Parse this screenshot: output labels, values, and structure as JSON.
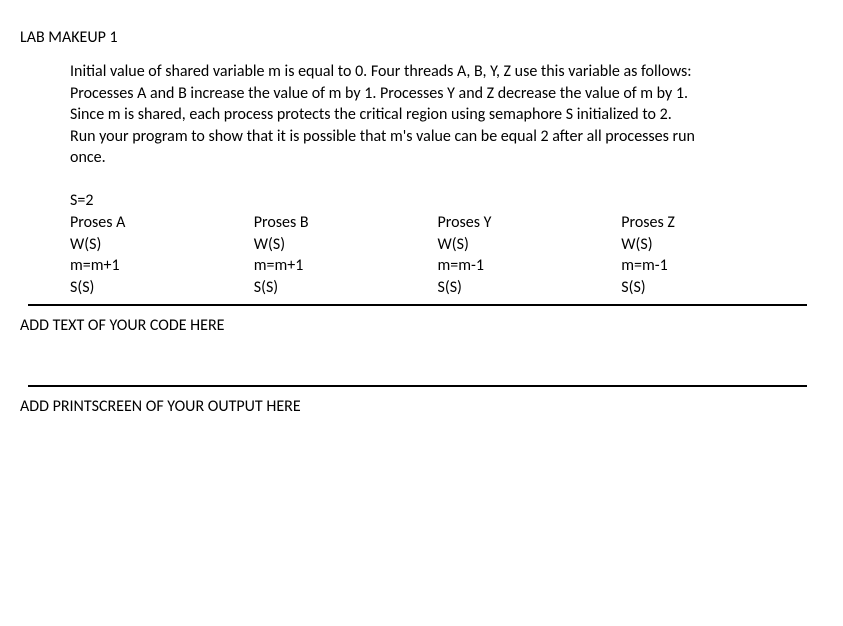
{
  "title": "LAB MAKEUP 1",
  "problem": {
    "line1": "Initial value of shared variable m is equal to 0. Four threads A, B, Y, Z use this variable as follows:",
    "line2": "Processes A and B increase the value of m by 1. Processes Y and Z decrease the value of m by 1.",
    "line3": "Since m is shared, each process protects the critical region using semaphore S initialized to 2.",
    "line4": "Run your program to show that it is possible that m's value can be equal 2 after all processes run",
    "line5": "once."
  },
  "semaphore_init": "S=2",
  "processes": [
    {
      "name": "Proses A",
      "wait": "W(S)",
      "op": "m=m+1",
      "signal": "S(S)"
    },
    {
      "name": "Proses B",
      "wait": "W(S)",
      "op": "m=m+1",
      "signal": "S(S)"
    },
    {
      "name": "Proses Y",
      "wait": "W(S)",
      "op": "m=m-1",
      "signal": "S(S)"
    },
    {
      "name": "Proses Z",
      "wait": "W(S)",
      "op": "m=m-1",
      "signal": "S(S)"
    }
  ],
  "section1_label": "ADD TEXT OF YOUR CODE HERE",
  "section2_label": "ADD PRINTSCREEN OF YOUR OUTPUT HERE"
}
